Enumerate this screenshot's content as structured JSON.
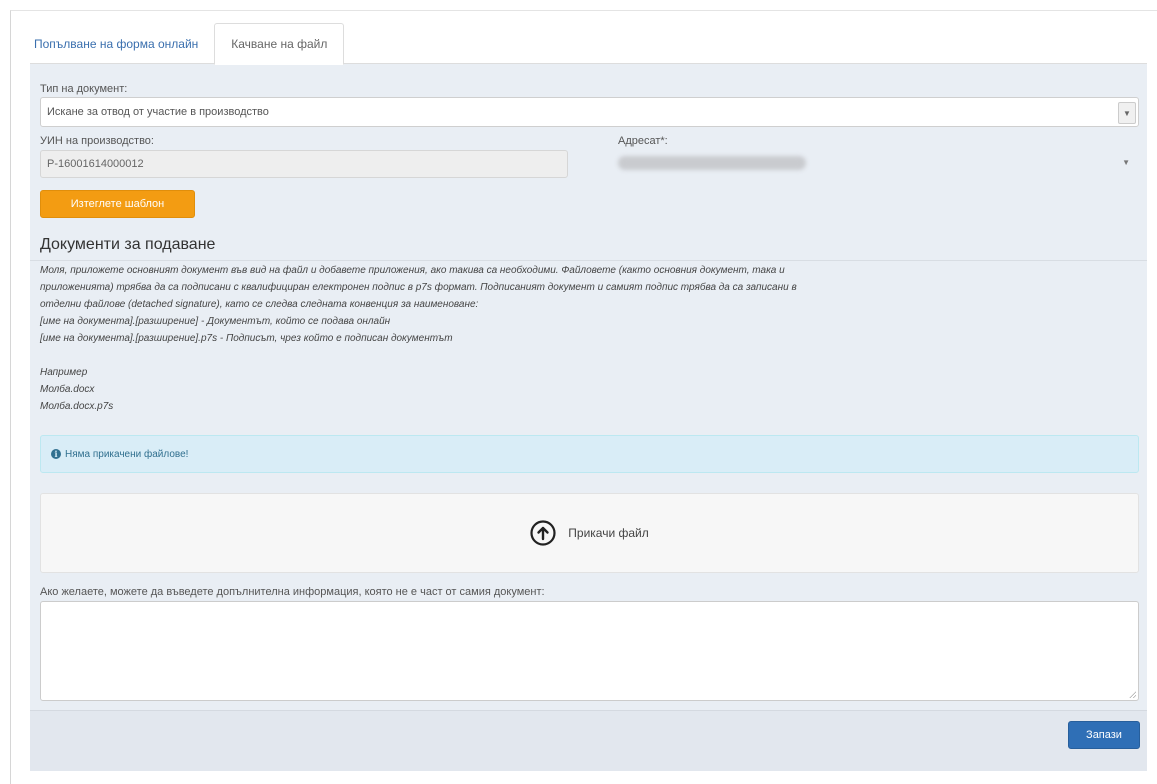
{
  "tabs": [
    {
      "label": "Попълване на форма онлайн",
      "active": false
    },
    {
      "label": "Качване на файл",
      "active": true
    }
  ],
  "form": {
    "document_type_label": "Тип на документ:",
    "document_type_value": "Искане за отвод от участие в производство",
    "case_id_label": "УИН на производство:",
    "case_id_value": "P-16001614000012",
    "addressee_label": "Адресат*:",
    "fill_template_button": "Изтеглете шаблон"
  },
  "documents": {
    "title": "Документи за подаване",
    "instructions_paragraph": [
      "Моля, приложете основният документ във вид на файл и добавете приложения, ако такива са необходими. Файловете (както основния документ, така и",
      "приложенията) трябва да са подписани с квалифициран електронен подпис в p7s формат. Подписаният документ и самият подпис трябва да са записани в",
      "отделни файлове (detached signature), като се следва следната конвенция за наименоване:"
    ],
    "convention_lines": [
      "[име на документа].[разширение] - Документът, който се подава онлайн",
      "[име на документа].[разширение].p7s - Подписът, чрез който е подписан документът"
    ],
    "example_title": "Например",
    "example_lines": [
      "Молба.docx",
      "Молба.docx.p7s"
    ],
    "no_files_message": "Няма прикачени файлове!",
    "attach_file_label": "Прикачи файл"
  },
  "additional_info": {
    "label": "Ако желаете, можете да въведете допълнителна информация, която не е част от самия документ:",
    "value": ""
  },
  "actions": {
    "save_label": "Запази"
  },
  "colors": {
    "tab_link": "#3a6fae",
    "panel_bg": "#e9eef4",
    "orange_button": "#f39c12",
    "primary_button": "#2f6fb6",
    "info_bg": "#d9edf7",
    "info_text": "#31708f"
  }
}
